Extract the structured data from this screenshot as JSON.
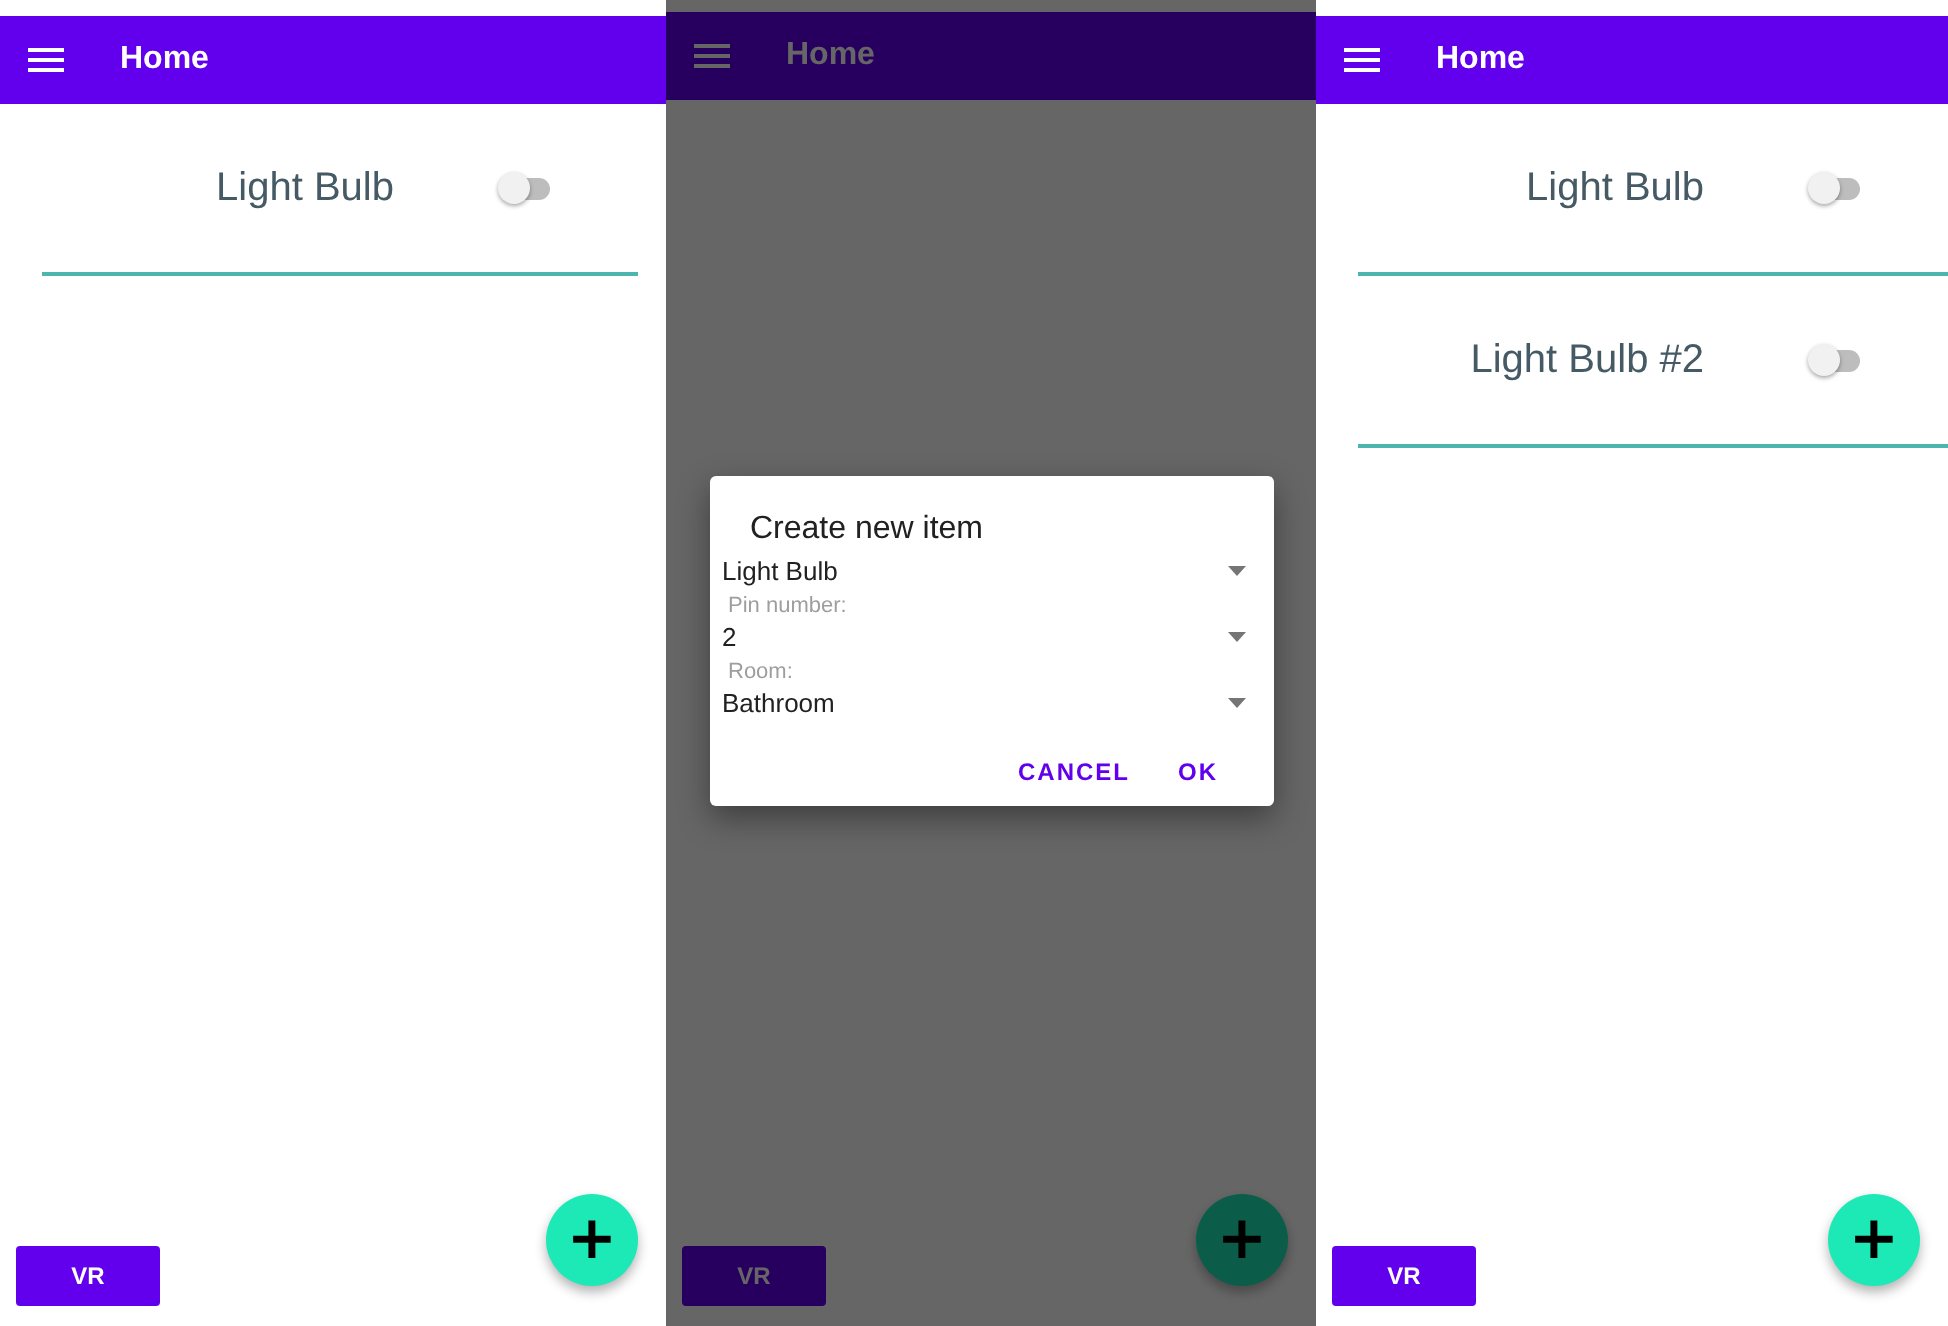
{
  "screens": [
    {
      "title": "Home",
      "items": [
        {
          "label": "Light Bulb",
          "on": false
        }
      ],
      "vr_label": "VR",
      "fab_icon": "+"
    },
    {
      "title": "Home",
      "vr_label": "VR",
      "fab_icon": "+",
      "dialog": {
        "title": "Create new item",
        "fields": [
          {
            "value": "Light Bulb"
          },
          {
            "label": "Pin number:",
            "value": "2"
          },
          {
            "label": "Room:",
            "value": "Bathroom"
          }
        ],
        "buttons": [
          "CANCEL",
          "OK"
        ]
      }
    },
    {
      "title": "Home",
      "items": [
        {
          "label": "Light Bulb",
          "on": false
        },
        {
          "label": "Light Bulb #2",
          "on": false
        }
      ],
      "vr_label": "VR",
      "fab_icon": "+"
    }
  ]
}
